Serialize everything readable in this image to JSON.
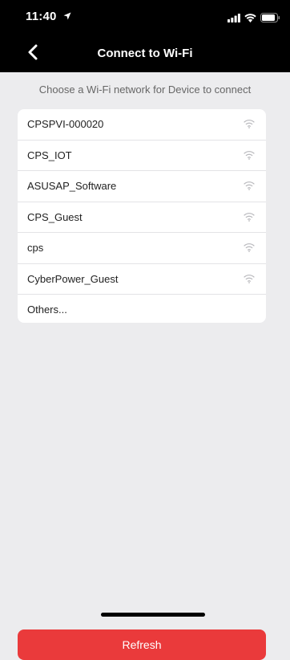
{
  "status_bar": {
    "time": "11:40",
    "icons": [
      "location-arrow-icon",
      "signal-icon",
      "wifi-status-icon",
      "battery-icon"
    ]
  },
  "nav": {
    "title": "Connect to Wi-Fi",
    "back_icon": "chevron-left-icon"
  },
  "subtitle": "Choose a Wi-Fi network for Device to connect",
  "networks": [
    {
      "name": "CPSPVI-000020",
      "icon": "wifi-icon"
    },
    {
      "name": "CPS_IOT",
      "icon": "wifi-icon"
    },
    {
      "name": "ASUSAP_Software",
      "icon": "wifi-icon"
    },
    {
      "name": "CPS_Guest",
      "icon": "wifi-icon"
    },
    {
      "name": "cps",
      "icon": "wifi-icon"
    },
    {
      "name": "CyberPower_Guest",
      "icon": "wifi-icon"
    },
    {
      "name": "Others..."
    }
  ],
  "refresh_label": "Refresh",
  "colors": {
    "accent": "#ea3a3b",
    "header_bg": "#000000",
    "page_bg": "#ececee"
  }
}
